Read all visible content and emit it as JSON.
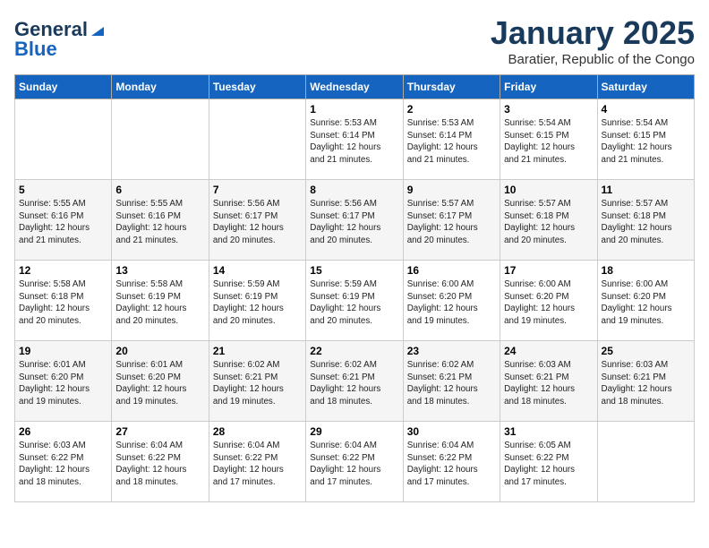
{
  "logo": {
    "line1": "General",
    "line2": "Blue"
  },
  "title": "January 2025",
  "subtitle": "Baratier, Republic of the Congo",
  "days_of_week": [
    "Sunday",
    "Monday",
    "Tuesday",
    "Wednesday",
    "Thursday",
    "Friday",
    "Saturday"
  ],
  "weeks": [
    [
      {
        "day": "",
        "info": ""
      },
      {
        "day": "",
        "info": ""
      },
      {
        "day": "",
        "info": ""
      },
      {
        "day": "1",
        "info": "Sunrise: 5:53 AM\nSunset: 6:14 PM\nDaylight: 12 hours\nand 21 minutes."
      },
      {
        "day": "2",
        "info": "Sunrise: 5:53 AM\nSunset: 6:14 PM\nDaylight: 12 hours\nand 21 minutes."
      },
      {
        "day": "3",
        "info": "Sunrise: 5:54 AM\nSunset: 6:15 PM\nDaylight: 12 hours\nand 21 minutes."
      },
      {
        "day": "4",
        "info": "Sunrise: 5:54 AM\nSunset: 6:15 PM\nDaylight: 12 hours\nand 21 minutes."
      }
    ],
    [
      {
        "day": "5",
        "info": "Sunrise: 5:55 AM\nSunset: 6:16 PM\nDaylight: 12 hours\nand 21 minutes."
      },
      {
        "day": "6",
        "info": "Sunrise: 5:55 AM\nSunset: 6:16 PM\nDaylight: 12 hours\nand 21 minutes."
      },
      {
        "day": "7",
        "info": "Sunrise: 5:56 AM\nSunset: 6:17 PM\nDaylight: 12 hours\nand 20 minutes."
      },
      {
        "day": "8",
        "info": "Sunrise: 5:56 AM\nSunset: 6:17 PM\nDaylight: 12 hours\nand 20 minutes."
      },
      {
        "day": "9",
        "info": "Sunrise: 5:57 AM\nSunset: 6:17 PM\nDaylight: 12 hours\nand 20 minutes."
      },
      {
        "day": "10",
        "info": "Sunrise: 5:57 AM\nSunset: 6:18 PM\nDaylight: 12 hours\nand 20 minutes."
      },
      {
        "day": "11",
        "info": "Sunrise: 5:57 AM\nSunset: 6:18 PM\nDaylight: 12 hours\nand 20 minutes."
      }
    ],
    [
      {
        "day": "12",
        "info": "Sunrise: 5:58 AM\nSunset: 6:18 PM\nDaylight: 12 hours\nand 20 minutes."
      },
      {
        "day": "13",
        "info": "Sunrise: 5:58 AM\nSunset: 6:19 PM\nDaylight: 12 hours\nand 20 minutes."
      },
      {
        "day": "14",
        "info": "Sunrise: 5:59 AM\nSunset: 6:19 PM\nDaylight: 12 hours\nand 20 minutes."
      },
      {
        "day": "15",
        "info": "Sunrise: 5:59 AM\nSunset: 6:19 PM\nDaylight: 12 hours\nand 20 minutes."
      },
      {
        "day": "16",
        "info": "Sunrise: 6:00 AM\nSunset: 6:20 PM\nDaylight: 12 hours\nand 19 minutes."
      },
      {
        "day": "17",
        "info": "Sunrise: 6:00 AM\nSunset: 6:20 PM\nDaylight: 12 hours\nand 19 minutes."
      },
      {
        "day": "18",
        "info": "Sunrise: 6:00 AM\nSunset: 6:20 PM\nDaylight: 12 hours\nand 19 minutes."
      }
    ],
    [
      {
        "day": "19",
        "info": "Sunrise: 6:01 AM\nSunset: 6:20 PM\nDaylight: 12 hours\nand 19 minutes."
      },
      {
        "day": "20",
        "info": "Sunrise: 6:01 AM\nSunset: 6:20 PM\nDaylight: 12 hours\nand 19 minutes."
      },
      {
        "day": "21",
        "info": "Sunrise: 6:02 AM\nSunset: 6:21 PM\nDaylight: 12 hours\nand 19 minutes."
      },
      {
        "day": "22",
        "info": "Sunrise: 6:02 AM\nSunset: 6:21 PM\nDaylight: 12 hours\nand 18 minutes."
      },
      {
        "day": "23",
        "info": "Sunrise: 6:02 AM\nSunset: 6:21 PM\nDaylight: 12 hours\nand 18 minutes."
      },
      {
        "day": "24",
        "info": "Sunrise: 6:03 AM\nSunset: 6:21 PM\nDaylight: 12 hours\nand 18 minutes."
      },
      {
        "day": "25",
        "info": "Sunrise: 6:03 AM\nSunset: 6:21 PM\nDaylight: 12 hours\nand 18 minutes."
      }
    ],
    [
      {
        "day": "26",
        "info": "Sunrise: 6:03 AM\nSunset: 6:22 PM\nDaylight: 12 hours\nand 18 minutes."
      },
      {
        "day": "27",
        "info": "Sunrise: 6:04 AM\nSunset: 6:22 PM\nDaylight: 12 hours\nand 18 minutes."
      },
      {
        "day": "28",
        "info": "Sunrise: 6:04 AM\nSunset: 6:22 PM\nDaylight: 12 hours\nand 17 minutes."
      },
      {
        "day": "29",
        "info": "Sunrise: 6:04 AM\nSunset: 6:22 PM\nDaylight: 12 hours\nand 17 minutes."
      },
      {
        "day": "30",
        "info": "Sunrise: 6:04 AM\nSunset: 6:22 PM\nDaylight: 12 hours\nand 17 minutes."
      },
      {
        "day": "31",
        "info": "Sunrise: 6:05 AM\nSunset: 6:22 PM\nDaylight: 12 hours\nand 17 minutes."
      },
      {
        "day": "",
        "info": ""
      }
    ]
  ]
}
